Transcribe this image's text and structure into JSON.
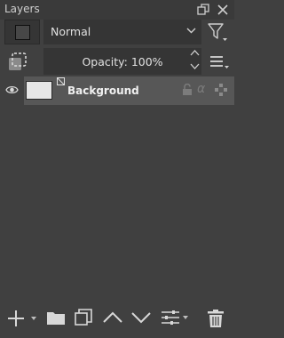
{
  "panel": {
    "title": "Layers"
  },
  "blend_mode": {
    "selected": "Normal"
  },
  "opacity": {
    "label": "Opacity:",
    "value": "100%"
  },
  "layers": [
    {
      "name": "Background",
      "visible": true,
      "selected": true
    }
  ],
  "icons": {
    "float": "float-icon",
    "close": "close-icon",
    "filter": "filter-icon",
    "add": "add-icon",
    "group": "folder-icon",
    "duplicate": "duplicate-icon",
    "move_up": "move-up-icon",
    "move_down": "move-down-icon",
    "properties": "properties-icon",
    "delete": "trash-icon"
  },
  "colors": {
    "panel_bg": "#404040",
    "field_bg": "#353535",
    "selected_row": "#575757",
    "icon": "#cfcfcf"
  }
}
